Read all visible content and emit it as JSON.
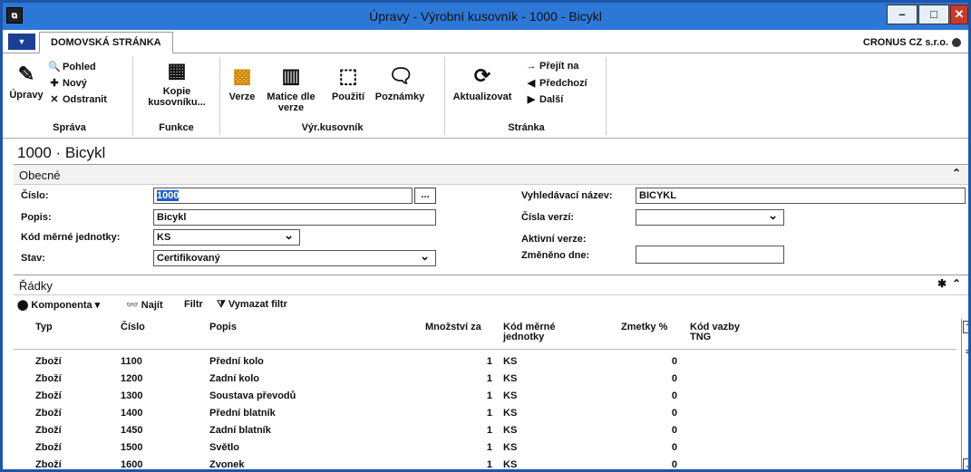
{
  "window": {
    "title": "Úpravy - Výrobní kusovník - 1000 - Bicykl",
    "app_icon": "nav-app-icon"
  },
  "tabs": {
    "home": "DOMOVSKÁ STRÁNKA"
  },
  "company": "CRONUS CZ s.r.o.",
  "ribbon": {
    "sprava": {
      "label": "Správa",
      "edit": "Úpravy",
      "view": "Pohled",
      "new": "Nový",
      "delete": "Odstranit"
    },
    "funkce": {
      "label": "Funkce",
      "copy": "Kopie kusovníku..."
    },
    "vyr": {
      "label": "Výr.kusovník",
      "versions": "Verze",
      "matrix": "Matice dle verze",
      "where_used": "Použití",
      "notes": "Poznámky"
    },
    "stranka": {
      "label": "Stránka",
      "refresh": "Aktualizovat",
      "goto": "Přejít na",
      "previous": "Předchozí",
      "next": "Další"
    }
  },
  "page": {
    "title": "1000 · Bicykl"
  },
  "general": {
    "heading": "Obecné",
    "cislo_label": "Číslo:",
    "cislo_value": "1000",
    "popis_label": "Popis:",
    "popis_value": "Bicykl",
    "kod_label": "Kód měrné jednotky:",
    "kod_value": "KS",
    "stav_label": "Stav:",
    "stav_value": "Certifikovaný",
    "vyhl_label": "Vyhledávací název:",
    "vyhl_value": "BICYKL",
    "cisla_verzi_label": "Čísla verzí:",
    "cisla_verzi_value": "",
    "aktivni_label": "Aktivní verze:",
    "zmeneno_label": "Změněno dne:",
    "zmeneno_value": ""
  },
  "lines": {
    "heading": "Řádky",
    "tools": {
      "component": "Komponenta",
      "find": "Najít",
      "filter": "Filtr",
      "clear_filter": "Vymazat filtr"
    },
    "columns": {
      "typ": "Typ",
      "cislo": "Číslo",
      "popis": "Popis",
      "mnozstvi": "Množství za",
      "kod1": "Kód měrné",
      "kod2": "jednotky",
      "zmetky": "Zmetky %",
      "vazba1": "Kód vazby",
      "vazba2": "TNG"
    },
    "rows": [
      {
        "typ": "Zboží",
        "cislo": "1100",
        "popis": "Přední kolo",
        "mnozstvi": "1",
        "kod": "KS",
        "zmetky": "0"
      },
      {
        "typ": "Zboží",
        "cislo": "1200",
        "popis": "Zadní kolo",
        "mnozstvi": "1",
        "kod": "KS",
        "zmetky": "0"
      },
      {
        "typ": "Zboží",
        "cislo": "1300",
        "popis": "Soustava převodů",
        "mnozstvi": "1",
        "kod": "KS",
        "zmetky": "0"
      },
      {
        "typ": "Zboží",
        "cislo": "1400",
        "popis": "Přední blatník",
        "mnozstvi": "1",
        "kod": "KS",
        "zmetky": "0"
      },
      {
        "typ": "Zboží",
        "cislo": "1450",
        "popis": "Zadní blatník",
        "mnozstvi": "1",
        "kod": "KS",
        "zmetky": "0"
      },
      {
        "typ": "Zboží",
        "cislo": "1500",
        "popis": "Světlo",
        "mnozstvi": "1",
        "kod": "KS",
        "zmetky": "0"
      },
      {
        "typ": "Zboží",
        "cislo": "1600",
        "popis": "Zvonek",
        "mnozstvi": "1",
        "kod": "KS",
        "zmetky": "0"
      }
    ]
  }
}
